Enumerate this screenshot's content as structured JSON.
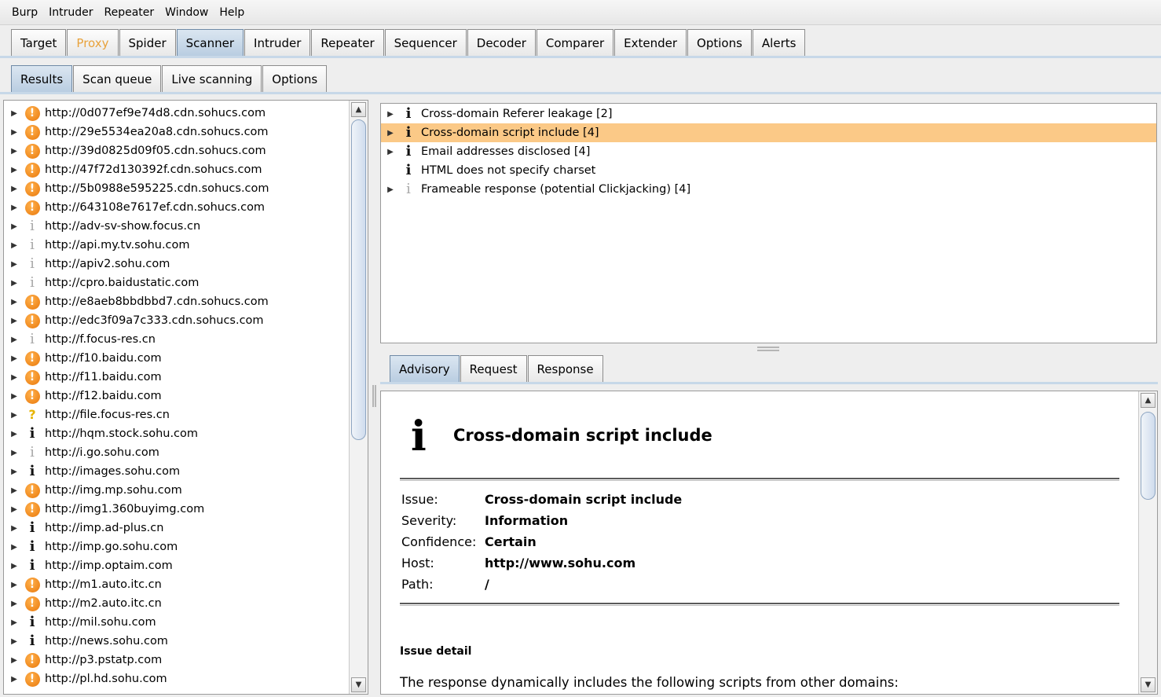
{
  "menu": [
    "Burp",
    "Intruder",
    "Repeater",
    "Window",
    "Help"
  ],
  "main_tabs": [
    {
      "label": "Target",
      "state": "normal"
    },
    {
      "label": "Proxy",
      "state": "highlight"
    },
    {
      "label": "Spider",
      "state": "normal"
    },
    {
      "label": "Scanner",
      "state": "active"
    },
    {
      "label": "Intruder",
      "state": "normal"
    },
    {
      "label": "Repeater",
      "state": "normal"
    },
    {
      "label": "Sequencer",
      "state": "normal"
    },
    {
      "label": "Decoder",
      "state": "normal"
    },
    {
      "label": "Comparer",
      "state": "normal"
    },
    {
      "label": "Extender",
      "state": "normal"
    },
    {
      "label": "Options",
      "state": "normal"
    },
    {
      "label": "Alerts",
      "state": "normal"
    }
  ],
  "sub_tabs": [
    {
      "label": "Results",
      "state": "active"
    },
    {
      "label": "Scan queue",
      "state": "normal"
    },
    {
      "label": "Live scanning",
      "state": "normal"
    },
    {
      "label": "Options",
      "state": "normal"
    }
  ],
  "hosts": [
    {
      "url": "http://0d077ef9e74d8.cdn.sohucs.com",
      "severity": "high"
    },
    {
      "url": "http://29e5534ea20a8.cdn.sohucs.com",
      "severity": "high"
    },
    {
      "url": "http://39d0825d09f05.cdn.sohucs.com",
      "severity": "high"
    },
    {
      "url": "http://47f72d130392f.cdn.sohucs.com",
      "severity": "high"
    },
    {
      "url": "http://5b0988e595225.cdn.sohucs.com",
      "severity": "high"
    },
    {
      "url": "http://643108e7617ef.cdn.sohucs.com",
      "severity": "high"
    },
    {
      "url": "http://adv-sv-show.focus.cn",
      "severity": "info-light"
    },
    {
      "url": "http://api.my.tv.sohu.com",
      "severity": "info-light"
    },
    {
      "url": "http://apiv2.sohu.com",
      "severity": "info-light"
    },
    {
      "url": "http://cpro.baidustatic.com",
      "severity": "info-light"
    },
    {
      "url": "http://e8aeb8bbdbbd7.cdn.sohucs.com",
      "severity": "high"
    },
    {
      "url": "http://edc3f09a7c333.cdn.sohucs.com",
      "severity": "high"
    },
    {
      "url": "http://f.focus-res.cn",
      "severity": "info-light"
    },
    {
      "url": "http://f10.baidu.com",
      "severity": "high"
    },
    {
      "url": "http://f11.baidu.com",
      "severity": "high"
    },
    {
      "url": "http://f12.baidu.com",
      "severity": "high"
    },
    {
      "url": "http://file.focus-res.cn",
      "severity": "question"
    },
    {
      "url": "http://hqm.stock.sohu.com",
      "severity": "info"
    },
    {
      "url": "http://i.go.sohu.com",
      "severity": "info-light"
    },
    {
      "url": "http://images.sohu.com",
      "severity": "info"
    },
    {
      "url": "http://img.mp.sohu.com",
      "severity": "high"
    },
    {
      "url": "http://img1.360buyimg.com",
      "severity": "high"
    },
    {
      "url": "http://imp.ad-plus.cn",
      "severity": "info"
    },
    {
      "url": "http://imp.go.sohu.com",
      "severity": "info"
    },
    {
      "url": "http://imp.optaim.com",
      "severity": "info"
    },
    {
      "url": "http://m1.auto.itc.cn",
      "severity": "high"
    },
    {
      "url": "http://m2.auto.itc.cn",
      "severity": "high"
    },
    {
      "url": "http://mil.sohu.com",
      "severity": "info"
    },
    {
      "url": "http://news.sohu.com",
      "severity": "info"
    },
    {
      "url": "http://p3.pstatp.com",
      "severity": "high"
    },
    {
      "url": "http://pl.hd.sohu.com",
      "severity": "high"
    }
  ],
  "issues": [
    {
      "label": "Cross-domain Referer leakage [2]",
      "severity": "info",
      "expandable": true,
      "selected": false
    },
    {
      "label": "Cross-domain script include [4]",
      "severity": "info",
      "expandable": true,
      "selected": true
    },
    {
      "label": "Email addresses disclosed [4]",
      "severity": "info",
      "expandable": true,
      "selected": false
    },
    {
      "label": "HTML does not specify charset",
      "severity": "info",
      "expandable": false,
      "selected": false
    },
    {
      "label": "Frameable response (potential Clickjacking) [4]",
      "severity": "info-light",
      "expandable": true,
      "selected": false
    }
  ],
  "detail_tabs": [
    {
      "label": "Advisory",
      "state": "active"
    },
    {
      "label": "Request",
      "state": "normal"
    },
    {
      "label": "Response",
      "state": "normal"
    }
  ],
  "advisory": {
    "icon": "i",
    "title": "Cross-domain script include",
    "fields": [
      {
        "key": "Issue:",
        "value": "Cross-domain script include"
      },
      {
        "key": "Severity:",
        "value": "Information"
      },
      {
        "key": "Confidence:",
        "value": "Certain"
      },
      {
        "key": "Host:",
        "value": "http://www.sohu.com"
      },
      {
        "key": "Path:",
        "value": "/"
      }
    ],
    "section_heading": "Issue detail",
    "detail_text": "The response dynamically includes the following scripts from other domains:"
  },
  "glyphs": {
    "expand_arrow": "▶",
    "scroll_up": "▲",
    "scroll_down": "▼",
    "high_icon": "!",
    "info_icon": "i",
    "question_icon": "?"
  },
  "colors": {
    "selected_row": "#fbc987",
    "high_severity": "#e9780a",
    "proxy_tab_text": "#e8a23c",
    "active_tab": "#b9cde1"
  }
}
